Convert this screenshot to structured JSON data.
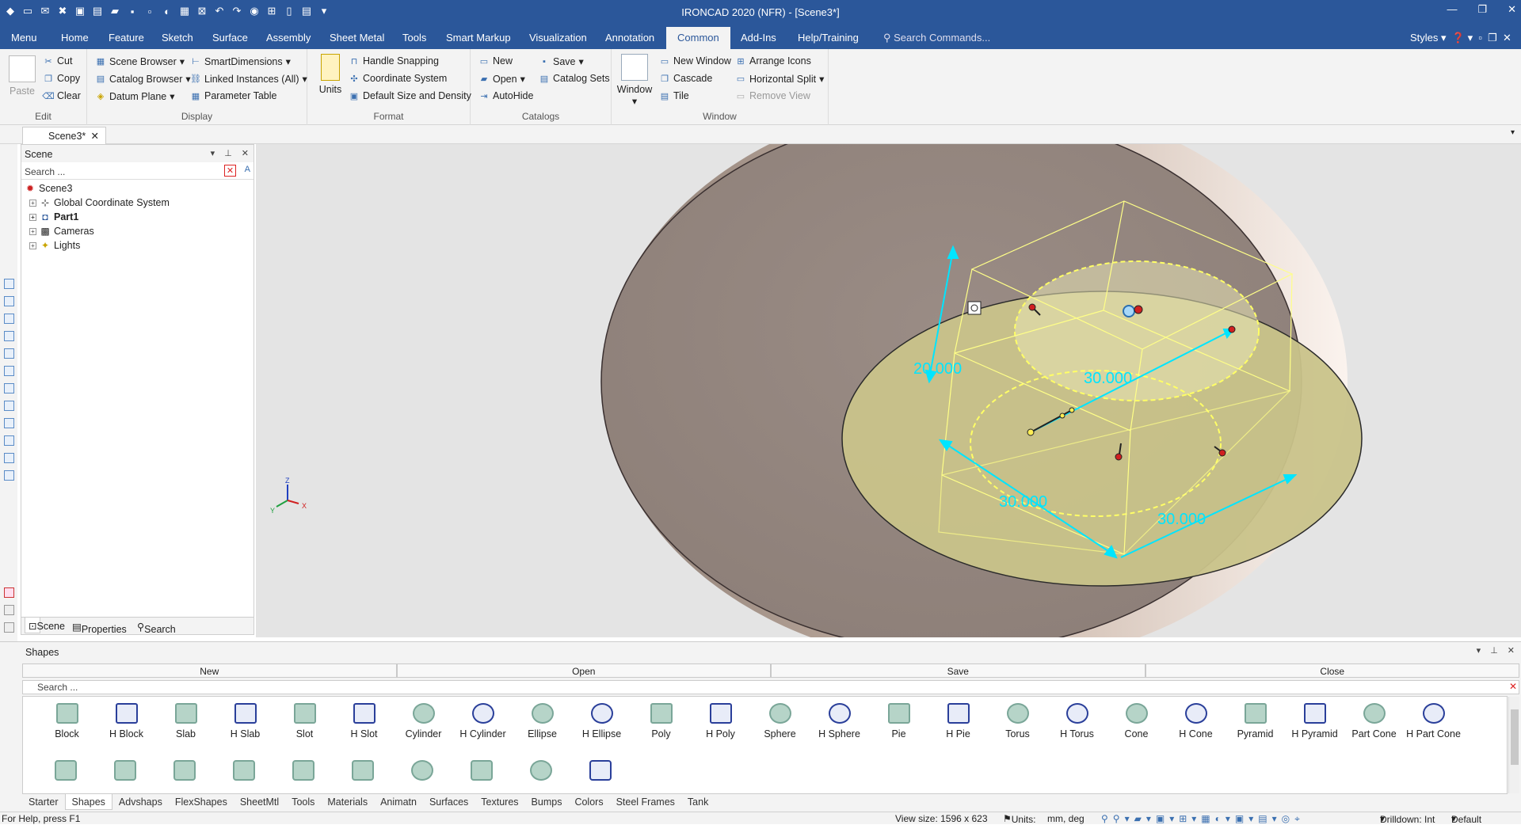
{
  "titlebar": {
    "title": "IRONCAD 2020 (NFR) - [Scene3*]"
  },
  "tabs": [
    "Menu",
    "Home",
    "Feature",
    "Sketch",
    "Surface",
    "Assembly",
    "Sheet Metal",
    "Tools",
    "Smart Markup",
    "Visualization",
    "Annotation",
    "Common",
    "Add-Ins",
    "Help/Training"
  ],
  "active_tab": "Common",
  "search_commands": "Search Commands...",
  "styles_label": "Styles",
  "ribbon": {
    "edit": {
      "label": "Edit",
      "paste": "Paste",
      "cut": "Cut",
      "copy": "Copy",
      "clear": "Clear"
    },
    "display": {
      "label": "Display",
      "scene_browser": "Scene Browser",
      "catalog_browser": "Catalog Browser",
      "datum_plane": "Datum Plane",
      "smart_dimensions": "SmartDimensions",
      "linked_instances": "Linked Instances (All)",
      "parameter_table": "Parameter Table"
    },
    "format": {
      "label": "Format",
      "units": "Units",
      "handle_snapping": "Handle Snapping",
      "coordinate_system": "Coordinate System",
      "default_size": "Default Size and Density"
    },
    "catalogs": {
      "label": "Catalogs",
      "new": "New",
      "open": "Open",
      "autohide": "AutoHide",
      "save": "Save",
      "catalog_sets": "Catalog Sets"
    },
    "window": {
      "label": "Window",
      "window": "Window",
      "new_window": "New Window",
      "cascade": "Cascade",
      "tile": "Tile",
      "arrange_icons": "Arrange Icons",
      "horizontal_split": "Horizontal Split",
      "remove_view": "Remove View"
    }
  },
  "doc_tab": "Scene3*",
  "scene_panel": {
    "title": "Scene",
    "search_placeholder": "Search ...",
    "tree": [
      {
        "label": "Scene3",
        "bold": false
      },
      {
        "label": "Global Coordinate System",
        "bold": false
      },
      {
        "label": "Part1",
        "bold": true
      },
      {
        "label": "Cameras",
        "bold": false
      },
      {
        "label": "Lights",
        "bold": false
      }
    ],
    "footer_tabs": [
      "Scene",
      "Properties",
      "Search"
    ]
  },
  "viewport": {
    "dim_height": "20.000",
    "dim_top": "30.000",
    "dim_left": "30.000",
    "dim_right": "30.000",
    "axes": {
      "z": "Z",
      "y": "Y",
      "x": "X"
    }
  },
  "shapes_panel": {
    "title": "Shapes",
    "buttons": [
      "New",
      "Open",
      "Save",
      "Close"
    ],
    "search_placeholder": "Search ...",
    "items": [
      "Block",
      "H Block",
      "Slab",
      "H Slab",
      "Slot",
      "H Slot",
      "Cylinder",
      "H Cylinder",
      "Ellipse",
      "H Ellipse",
      "Poly",
      "H Poly",
      "Sphere",
      "H Sphere",
      "Pie",
      "H Pie",
      "Torus",
      "H Torus",
      "Cone",
      "H Cone",
      "Pyramid",
      "H Pyramid",
      "Part Cone",
      "H Part Cone"
    ],
    "categories": [
      "Starter",
      "Shapes",
      "Advshaps",
      "FlexShapes",
      "SheetMtl",
      "Tools",
      "Materials",
      "Animatn",
      "Surfaces",
      "Textures",
      "Bumps",
      "Colors",
      "Steel Frames",
      "Tank"
    ],
    "active_category": "Shapes"
  },
  "status": {
    "help": "For Help, press F1",
    "view_size": "View size: 1596 x  623",
    "units_label": "Units:",
    "units_value": "mm, deg",
    "drilldown": "Drilldown: Int",
    "default": "Default"
  },
  "colors": {
    "accent": "#2b579a",
    "dimension": "#00e5ff",
    "selection": "#ffff66"
  }
}
